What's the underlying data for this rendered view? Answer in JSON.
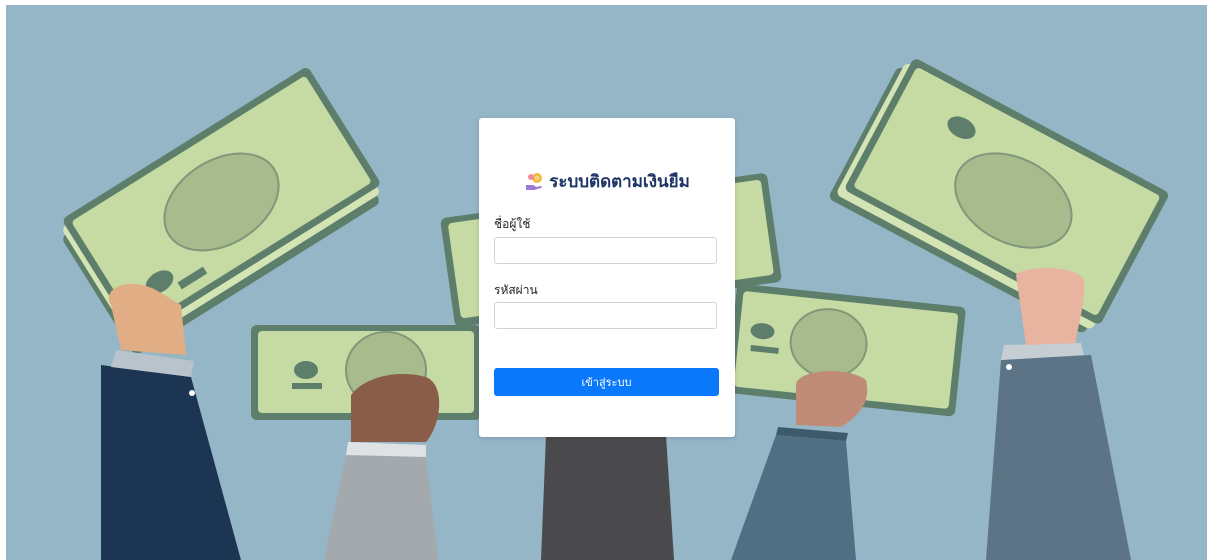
{
  "app": {
    "title": "ระบบติดตามเงินยืม"
  },
  "form": {
    "username_label": "ชื่อผู้ใช้",
    "username_value": "",
    "password_label": "รหัสผ่าน",
    "password_value": "",
    "submit_label": "เข้าสู่ระบบ"
  },
  "icons": {
    "brand": "coin-hand-icon"
  },
  "colors": {
    "background": "#94b6c7",
    "primary_button": "#0a78fb",
    "title_text": "#1e3566",
    "banknote": "#c5dba3",
    "banknote_dark": "#5e7e6c"
  }
}
